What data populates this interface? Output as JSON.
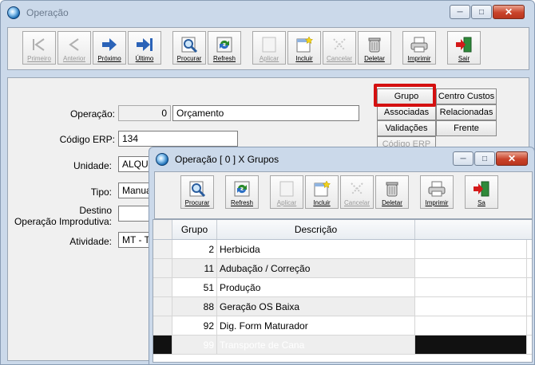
{
  "main_window": {
    "title": "Operação",
    "toolbar": [
      {
        "label": "Primeiro",
        "icon": "first-icon",
        "enabled": false
      },
      {
        "label": "Anterior",
        "icon": "previous-icon",
        "enabled": false
      },
      {
        "label": "Próximo",
        "icon": "next-arrow-icon",
        "enabled": true
      },
      {
        "label": "Último",
        "icon": "last-arrow-icon",
        "enabled": true
      },
      {
        "label": "Procurar",
        "icon": "search-icon",
        "enabled": true
      },
      {
        "label": "Refresh",
        "icon": "refresh-icon",
        "enabled": true
      },
      {
        "label": "Aplicar",
        "icon": "apply-icon",
        "enabled": false
      },
      {
        "label": "Incluir",
        "icon": "include-icon",
        "enabled": true
      },
      {
        "label": "Cancelar",
        "icon": "cancel-icon",
        "enabled": false
      },
      {
        "label": "Deletar",
        "icon": "trash-icon",
        "enabled": true
      },
      {
        "label": "Imprimir",
        "icon": "printer-icon",
        "enabled": true
      },
      {
        "label": "Sair",
        "icon": "exit-icon",
        "enabled": true
      }
    ],
    "form": {
      "operacao_label": "Operação:",
      "operacao_code": "0",
      "operacao_name": "Orçamento",
      "codigo_erp_label": "Código ERP:",
      "codigo_erp_value": "134",
      "unidade_label": "Unidade:",
      "unidade_value": "ALQUE",
      "tipo_label": "Tipo:",
      "tipo_value": "Manua",
      "destino_label_1": "Destino",
      "destino_label_2": "Operação Improdutiva:",
      "destino_value": "",
      "atividade_label": "Atividade:",
      "atividade_value": "MT - TI"
    },
    "side_buttons": {
      "grupo": "Grupo",
      "centro_custos": "Centro Custos",
      "associadas": "Associadas",
      "relacionadas": "Relacionadas",
      "validacoes": "Validações",
      "frente": "Frente",
      "codigo_erp": "Código ERP"
    },
    "highlight_color": "#d41010"
  },
  "dialog": {
    "title": "Operação [ 0 ] X Grupos",
    "toolbar": [
      {
        "label": "Procurar",
        "icon": "search-icon",
        "enabled": true
      },
      {
        "label": "Refresh",
        "icon": "refresh-icon",
        "enabled": true
      },
      {
        "label": "Aplicar",
        "icon": "apply-icon",
        "enabled": false
      },
      {
        "label": "Incluir",
        "icon": "include-icon",
        "enabled": true
      },
      {
        "label": "Cancelar",
        "icon": "cancel-icon",
        "enabled": false
      },
      {
        "label": "Deletar",
        "icon": "trash-icon",
        "enabled": true
      },
      {
        "label": "Imprimir",
        "icon": "printer-icon",
        "enabled": true
      },
      {
        "label": "Sa",
        "icon": "exit-icon",
        "enabled": true
      }
    ],
    "grid": {
      "columns": [
        "Grupo",
        "Descrição"
      ],
      "rows": [
        {
          "grupo": "2",
          "descricao": "Herbicida"
        },
        {
          "grupo": "11",
          "descricao": "Adubação / Correção"
        },
        {
          "grupo": "51",
          "descricao": "Produção"
        },
        {
          "grupo": "88",
          "descricao": "Geração OS Baixa"
        },
        {
          "grupo": "92",
          "descricao": "Dig. Form Maturador"
        },
        {
          "grupo": "99",
          "descricao": "Transporte de Cana"
        }
      ],
      "selected_row": 5
    }
  }
}
